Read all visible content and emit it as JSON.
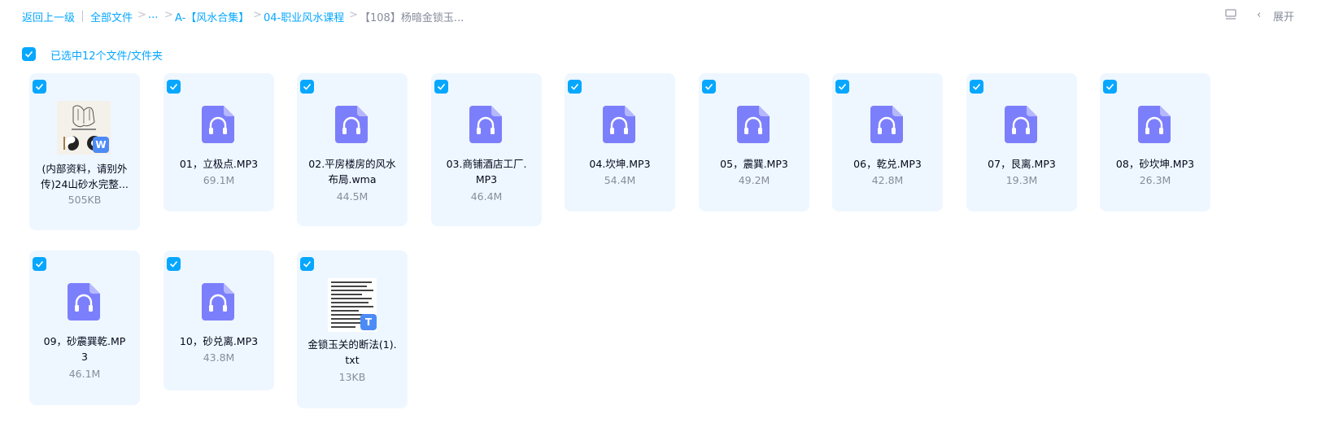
{
  "breadcrumb": {
    "back": "返回上一级",
    "all_files": "全部文件",
    "ellipsis": "...",
    "folder_a": "A-【风水合集】",
    "folder_b": "04-职业风水课程",
    "current": "【108】杨暗金锁玉..."
  },
  "separators": [
    ">",
    ">",
    ">",
    ">"
  ],
  "toolbar": {
    "expand_label": "展开",
    "chevron": "‹"
  },
  "selection": {
    "label": "已选中12个文件/文件夹",
    "checked": true
  },
  "colors": {
    "accent": "#06a7ff",
    "audio_icon": "#7c7ffb",
    "word_badge": "#4c8bf5",
    "txt_badge": "#4c8bf5",
    "card_bg": "#eef7ff"
  },
  "files": [
    {
      "name_lines": [
        "(内部资料，请别外",
        "传)24山砂水完整..."
      ],
      "size": "505KB",
      "icon": "word-doc-thumbnail",
      "badge": "W"
    },
    {
      "name_lines": [
        "01，立极点.MP3"
      ],
      "size": "69.1M",
      "icon": "audio-file-icon"
    },
    {
      "name_lines": [
        "02.平房楼房的风水",
        "布局.wma"
      ],
      "size": "44.5M",
      "icon": "audio-file-icon"
    },
    {
      "name_lines": [
        "03.商铺酒店工厂.",
        "MP3"
      ],
      "size": "46.4M",
      "icon": "audio-file-icon"
    },
    {
      "name_lines": [
        "04.坎坤.MP3"
      ],
      "size": "54.4M",
      "icon": "audio-file-icon"
    },
    {
      "name_lines": [
        "05，震巽.MP3"
      ],
      "size": "49.2M",
      "icon": "audio-file-icon"
    },
    {
      "name_lines": [
        "06，乾兑.MP3"
      ],
      "size": "42.8M",
      "icon": "audio-file-icon"
    },
    {
      "name_lines": [
        "07，艮离.MP3"
      ],
      "size": "19.3M",
      "icon": "audio-file-icon"
    },
    {
      "name_lines": [
        "08，砂坎坤.MP3"
      ],
      "size": "26.3M",
      "icon": "audio-file-icon"
    },
    {
      "name_lines": [
        "09，砂震巽乾.MP",
        "3"
      ],
      "size": "46.1M",
      "icon": "audio-file-icon"
    },
    {
      "name_lines": [
        "10，砂兑离.MP3"
      ],
      "size": "43.8M",
      "icon": "audio-file-icon"
    },
    {
      "name_lines": [
        "金锁玉关的断法(1).",
        "txt"
      ],
      "size": "13KB",
      "icon": "txt-file-thumbnail",
      "badge": "T"
    }
  ]
}
